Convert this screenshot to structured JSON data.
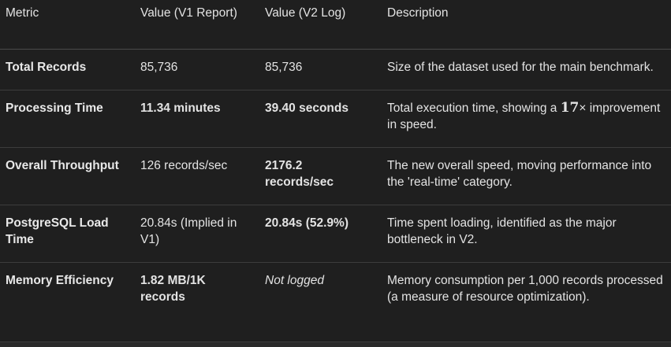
{
  "headers": [
    "Metric",
    "Value (V1 Report)",
    "Value (V2 Log)",
    "Description"
  ],
  "rows": [
    {
      "metric": "Total Records",
      "v1": "85,736",
      "v2": "85,736",
      "description": "Size of the dataset used for the main benchmark."
    },
    {
      "metric": "Processing Time",
      "v1": "11.34 minutes",
      "v2": "39.40 seconds",
      "description_pre": "Total execution time, showing a ",
      "description_em": "17",
      "description_times": "×",
      "description_post": " improvement in speed."
    },
    {
      "metric": "Overall Throughput",
      "v1": "126 records/sec",
      "v2": "2176.2 records/sec",
      "description": "The new overall speed, moving performance into the 'real-time' category."
    },
    {
      "metric": "PostgreSQL Load Time",
      "v1": "20.84s (Implied in V1)",
      "v2": "20.84s (52.9%)",
      "description": "Time spent loading, identified as the major bottleneck in V2."
    },
    {
      "metric": "Memory Efficiency",
      "v1": "1.82 MB/1K records",
      "v2": "Not logged",
      "description": "Memory consumption per 1,000 records processed (a measure of resource optimization)."
    }
  ]
}
